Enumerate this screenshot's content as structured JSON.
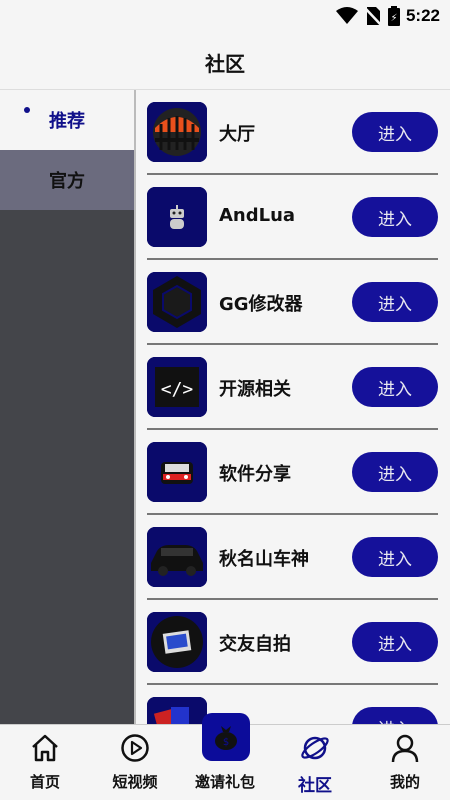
{
  "status": {
    "time": "5:22",
    "icons": [
      "wifi-icon",
      "no-sim-icon",
      "battery-icon"
    ]
  },
  "header": {
    "title": "社区"
  },
  "sidebar": {
    "items": [
      {
        "label": "推荐",
        "selected": true
      },
      {
        "label": "官方",
        "selected": false
      }
    ]
  },
  "list": {
    "items": [
      {
        "label": "大厅",
        "button": "进入",
        "icon": "bridge-icon"
      },
      {
        "label": "AndLua",
        "button": "进入",
        "icon": "robot-icon"
      },
      {
        "label": "GG修改器",
        "button": "进入",
        "icon": "hexagon-icon"
      },
      {
        "label": "开源相关",
        "button": "进入",
        "icon": "code-icon"
      },
      {
        "label": "软件分享",
        "button": "进入",
        "icon": "car-front-icon"
      },
      {
        "label": "秋名山车神",
        "button": "进入",
        "icon": "car-icon"
      },
      {
        "label": "交友自拍",
        "button": "进入",
        "icon": "photo-icon"
      },
      {
        "label": "",
        "button": "进入",
        "icon": "cards-icon"
      }
    ]
  },
  "bottom_nav": {
    "items": [
      {
        "label": "首页",
        "icon": "home-icon"
      },
      {
        "label": "短视频",
        "icon": "play-icon"
      },
      {
        "label": "邀请礼包",
        "icon": "gift-bag-icon"
      },
      {
        "label": "社区",
        "icon": "planet-icon",
        "active": true
      },
      {
        "label": "我的",
        "icon": "person-icon"
      }
    ]
  },
  "colors": {
    "accent": "#15119a",
    "sidebar_bg": "#44454a",
    "sidebar_inactive": "#6b6b7e"
  }
}
